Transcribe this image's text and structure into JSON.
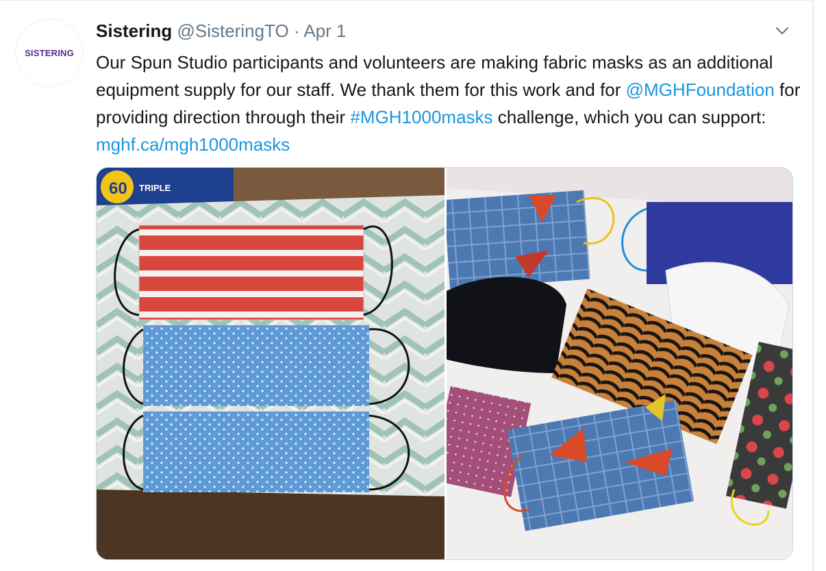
{
  "tweet": {
    "avatar_text": "SISTERING",
    "display_name": "Sistering",
    "handle": "@SisteringTO",
    "separator": "·",
    "date": "Apr 1",
    "menu_icon": "chevron-down-icon",
    "text_1": "Our Spun Studio participants and volunteers are making fabric masks as an additional equipment supply for our staff. We thank them for this work and for ",
    "mention": "@MGHFoundation",
    "text_2": " for providing direction through their ",
    "hashtag": "#MGH1000masks",
    "text_3": " challenge, which you can support: ",
    "url": "mghf.ca/mgh1000masks"
  },
  "media": {
    "photo_1_label": "60",
    "photo_1_text": "TRIPLE"
  },
  "colors": {
    "link": "#1b95e0",
    "secondary": "#657786",
    "brand": "#5b2a86"
  }
}
